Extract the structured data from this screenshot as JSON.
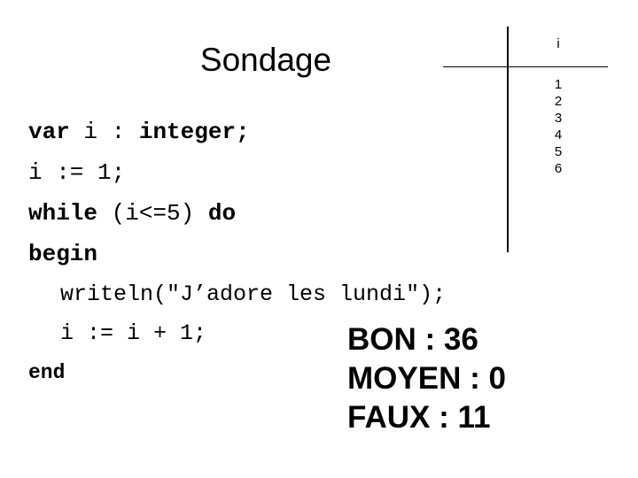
{
  "slide": {
    "title": "Sondage",
    "background_color": "#ffffff",
    "text_color": "#000000"
  },
  "code": {
    "language": "Pascal",
    "lines": [
      {
        "id": "var",
        "indent": 0,
        "parts": [
          {
            "text": "var ",
            "weight": "bold"
          },
          {
            "text": "i : ",
            "weight": "regular"
          },
          {
            "text": "integer;",
            "weight": "bold"
          }
        ]
      },
      {
        "id": "assign",
        "indent": 0,
        "parts": [
          {
            "text": "i := 1;",
            "weight": "regular"
          }
        ]
      },
      {
        "id": "while",
        "indent": 0,
        "parts": [
          {
            "text": "while ",
            "weight": "bold"
          },
          {
            "text": "(i<=5) ",
            "weight": "regular"
          },
          {
            "text": "do",
            "weight": "bold"
          }
        ]
      },
      {
        "id": "begin",
        "indent": 0,
        "parts": [
          {
            "text": "begin",
            "weight": "bold"
          }
        ]
      },
      {
        "id": "writeln",
        "indent": 1,
        "parts": [
          {
            "text": "writeln(\"J’adore les lundi\");",
            "weight": "regular"
          }
        ]
      },
      {
        "id": "incr",
        "indent": 1,
        "parts": [
          {
            "text": "i := i + 1;",
            "weight": "regular"
          }
        ]
      },
      {
        "id": "end",
        "indent": 0,
        "parts": [
          {
            "text": "end",
            "weight": "bold"
          }
        ]
      }
    ],
    "line_var_kw": "var ",
    "line_var_name": "i : ",
    "line_var_type": "integer;",
    "line_assign": "i := 1;",
    "line_while_kw": "while ",
    "line_while_cond": "(i<=5) ",
    "line_while_do": "do",
    "line_begin": "begin",
    "line_writeln": "writeln(\"J’adore les lundi\");",
    "line_incr": "i := i + 1;",
    "line_end": "end"
  },
  "trace_table": {
    "column_header": "i",
    "values": [
      "1",
      "2",
      "3",
      "4",
      "5",
      "6"
    ],
    "line_color": "#000000"
  },
  "results": {
    "lines": [
      {
        "label": "BON",
        "value": "36",
        "text": "BON : 36"
      },
      {
        "label": "MOYEN",
        "value": "0",
        "text": "MOYEN : 0"
      },
      {
        "label": "FAUX",
        "value": "11",
        "text": "FAUX : 11"
      }
    ],
    "bon": "BON : 36",
    "moyen": "MOYEN : 0",
    "faux": "FAUX : 11"
  }
}
